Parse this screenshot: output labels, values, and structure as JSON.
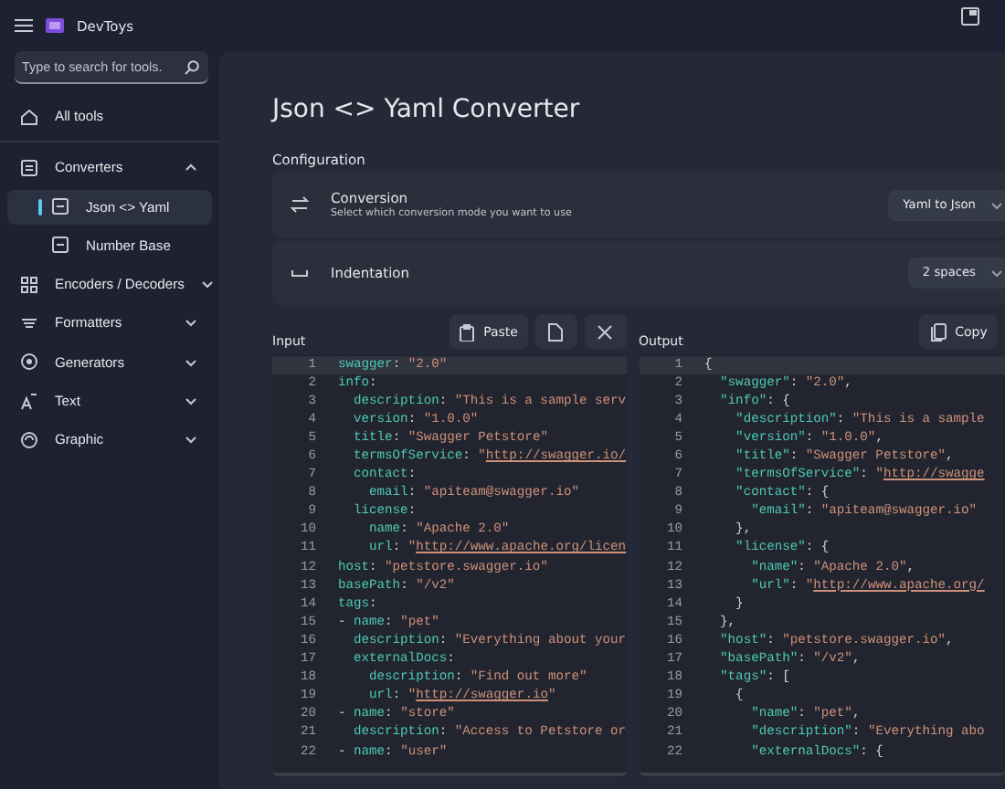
{
  "app": {
    "title": "DevToys"
  },
  "search": {
    "placeholder": "Type to search for tools."
  },
  "nav": [
    {
      "kind": "link",
      "label": "All tools",
      "selected": false
    },
    {
      "kind": "group",
      "label": "Converters",
      "selected": false,
      "expanded": true,
      "children": [
        {
          "label": "Json <> Yaml",
          "selected": true
        },
        {
          "label": "Number Base",
          "selected": false
        }
      ]
    },
    {
      "kind": "group",
      "label": "Encoders / Decoders",
      "selected": false,
      "expanded": false
    },
    {
      "kind": "group",
      "label": "Formatters",
      "selected": false,
      "expanded": false
    },
    {
      "kind": "group",
      "label": "Generators",
      "selected": false,
      "expanded": false
    },
    {
      "kind": "group",
      "label": "Text",
      "selected": false,
      "expanded": false
    },
    {
      "kind": "group",
      "label": "Graphic",
      "selected": false,
      "expanded": false
    }
  ],
  "tool": {
    "title": "Json <> Yaml Converter",
    "section": "Configuration",
    "settings": [
      {
        "kind": "conversion",
        "label": "Conversion",
        "description": "Select which conversion mode you want to use",
        "value": "Yaml to Json"
      },
      {
        "kind": "indentation",
        "label": "Indentation",
        "value": "2 spaces"
      }
    ]
  },
  "input": {
    "label": "Input",
    "actions": [
      {
        "kind": "paste",
        "label": "Paste"
      },
      {
        "kind": "open"
      },
      {
        "kind": "clear"
      }
    ],
    "lines": [
      {
        "number": "1",
        "current": true,
        "tokens": [
          {
            "kind": "key",
            "text": "swagger"
          },
          {
            "kind": "punct",
            "text": ": "
          },
          {
            "kind": "str",
            "text": "\"2.0\""
          }
        ]
      },
      {
        "number": "2",
        "current": false,
        "tokens": [
          {
            "kind": "key",
            "text": "info"
          },
          {
            "kind": "punct",
            "text": ":"
          }
        ]
      },
      {
        "number": "3",
        "current": false,
        "tokens": [
          {
            "kind": "key",
            "text": "  description"
          },
          {
            "kind": "punct",
            "text": ": "
          },
          {
            "kind": "str",
            "text": "\"This is a sample serv"
          }
        ]
      },
      {
        "number": "4",
        "current": false,
        "tokens": [
          {
            "kind": "key",
            "text": "  version"
          },
          {
            "kind": "punct",
            "text": ": "
          },
          {
            "kind": "str",
            "text": "\"1.0.0\""
          }
        ]
      },
      {
        "number": "5",
        "current": false,
        "tokens": [
          {
            "kind": "key",
            "text": "  title"
          },
          {
            "kind": "punct",
            "text": ": "
          },
          {
            "kind": "str",
            "text": "\"Swagger Petstore\""
          }
        ]
      },
      {
        "number": "6",
        "current": false,
        "tokens": [
          {
            "kind": "key",
            "text": "  termsOfService"
          },
          {
            "kind": "punct",
            "text": ": "
          },
          {
            "kind": "str",
            "text": "\""
          },
          {
            "kind": "url",
            "text": "http://swagger.io/"
          }
        ]
      },
      {
        "number": "7",
        "current": false,
        "tokens": [
          {
            "kind": "key",
            "text": "  contact"
          },
          {
            "kind": "punct",
            "text": ":"
          }
        ]
      },
      {
        "number": "8",
        "current": false,
        "tokens": [
          {
            "kind": "key",
            "text": "    email"
          },
          {
            "kind": "punct",
            "text": ": "
          },
          {
            "kind": "str",
            "text": "\"apiteam@swagger.io\""
          }
        ]
      },
      {
        "number": "9",
        "current": false,
        "tokens": [
          {
            "kind": "key",
            "text": "  license"
          },
          {
            "kind": "punct",
            "text": ":"
          }
        ]
      },
      {
        "number": "10",
        "current": false,
        "tokens": [
          {
            "kind": "key",
            "text": "    name"
          },
          {
            "kind": "punct",
            "text": ": "
          },
          {
            "kind": "str",
            "text": "\"Apache 2.0\""
          }
        ]
      },
      {
        "number": "11",
        "current": false,
        "tokens": [
          {
            "kind": "key",
            "text": "    url"
          },
          {
            "kind": "punct",
            "text": ": "
          },
          {
            "kind": "str",
            "text": "\""
          },
          {
            "kind": "url",
            "text": "http://www.apache.org/licen"
          }
        ]
      },
      {
        "number": "12",
        "current": false,
        "tokens": [
          {
            "kind": "key",
            "text": "host"
          },
          {
            "kind": "punct",
            "text": ": "
          },
          {
            "kind": "str",
            "text": "\"petstore.swagger.io\""
          }
        ]
      },
      {
        "number": "13",
        "current": false,
        "tokens": [
          {
            "kind": "key",
            "text": "basePath"
          },
          {
            "kind": "punct",
            "text": ": "
          },
          {
            "kind": "str",
            "text": "\"/v2\""
          }
        ]
      },
      {
        "number": "14",
        "current": false,
        "tokens": [
          {
            "kind": "key",
            "text": "tags"
          },
          {
            "kind": "punct",
            "text": ":"
          }
        ]
      },
      {
        "number": "15",
        "current": false,
        "tokens": [
          {
            "kind": "punct",
            "text": "- "
          },
          {
            "kind": "key",
            "text": "name"
          },
          {
            "kind": "punct",
            "text": ": "
          },
          {
            "kind": "str",
            "text": "\"pet\""
          }
        ]
      },
      {
        "number": "16",
        "current": false,
        "tokens": [
          {
            "kind": "key",
            "text": "  description"
          },
          {
            "kind": "punct",
            "text": ": "
          },
          {
            "kind": "str",
            "text": "\"Everything about your"
          }
        ]
      },
      {
        "number": "17",
        "current": false,
        "tokens": [
          {
            "kind": "key",
            "text": "  externalDocs"
          },
          {
            "kind": "punct",
            "text": ":"
          }
        ]
      },
      {
        "number": "18",
        "current": false,
        "tokens": [
          {
            "kind": "key",
            "text": "    description"
          },
          {
            "kind": "punct",
            "text": ": "
          },
          {
            "kind": "str",
            "text": "\"Find out more\""
          }
        ]
      },
      {
        "number": "19",
        "current": false,
        "tokens": [
          {
            "kind": "key",
            "text": "    url"
          },
          {
            "kind": "punct",
            "text": ": "
          },
          {
            "kind": "str",
            "text": "\""
          },
          {
            "kind": "url",
            "text": "http://swagger.io"
          },
          {
            "kind": "str",
            "text": "\""
          }
        ]
      },
      {
        "number": "20",
        "current": false,
        "tokens": [
          {
            "kind": "punct",
            "text": "- "
          },
          {
            "kind": "key",
            "text": "name"
          },
          {
            "kind": "punct",
            "text": ": "
          },
          {
            "kind": "str",
            "text": "\"store\""
          }
        ]
      },
      {
        "number": "21",
        "current": false,
        "tokens": [
          {
            "kind": "key",
            "text": "  description"
          },
          {
            "kind": "punct",
            "text": ": "
          },
          {
            "kind": "str",
            "text": "\"Access to Petstore or"
          }
        ]
      },
      {
        "number": "22",
        "current": false,
        "tokens": [
          {
            "kind": "punct",
            "text": "- "
          },
          {
            "kind": "key",
            "text": "name"
          },
          {
            "kind": "punct",
            "text": ": "
          },
          {
            "kind": "str",
            "text": "\"user\""
          }
        ]
      }
    ]
  },
  "output": {
    "label": "Output",
    "actions": [
      {
        "kind": "copy",
        "label": "Copy"
      }
    ],
    "lines": [
      {
        "number": "1",
        "current": true,
        "tokens": [
          {
            "kind": "punct",
            "text": "{"
          }
        ]
      },
      {
        "number": "2",
        "current": false,
        "tokens": [
          {
            "kind": "key",
            "text": "  \"swagger\""
          },
          {
            "kind": "punct",
            "text": ": "
          },
          {
            "kind": "str",
            "text": "\"2.0\""
          },
          {
            "kind": "punct",
            "text": ","
          }
        ]
      },
      {
        "number": "3",
        "current": false,
        "tokens": [
          {
            "kind": "key",
            "text": "  \"info\""
          },
          {
            "kind": "punct",
            "text": ": {"
          }
        ]
      },
      {
        "number": "4",
        "current": false,
        "tokens": [
          {
            "kind": "key",
            "text": "    \"description\""
          },
          {
            "kind": "punct",
            "text": ": "
          },
          {
            "kind": "str",
            "text": "\"This is a sample"
          }
        ]
      },
      {
        "number": "5",
        "current": false,
        "tokens": [
          {
            "kind": "key",
            "text": "    \"version\""
          },
          {
            "kind": "punct",
            "text": ": "
          },
          {
            "kind": "str",
            "text": "\"1.0.0\""
          },
          {
            "kind": "punct",
            "text": ","
          }
        ]
      },
      {
        "number": "6",
        "current": false,
        "tokens": [
          {
            "kind": "key",
            "text": "    \"title\""
          },
          {
            "kind": "punct",
            "text": ": "
          },
          {
            "kind": "str",
            "text": "\"Swagger Petstore\""
          },
          {
            "kind": "punct",
            "text": ","
          }
        ]
      },
      {
        "number": "7",
        "current": false,
        "tokens": [
          {
            "kind": "key",
            "text": "    \"termsOfService\""
          },
          {
            "kind": "punct",
            "text": ": "
          },
          {
            "kind": "str",
            "text": "\""
          },
          {
            "kind": "url",
            "text": "http://swagge"
          }
        ]
      },
      {
        "number": "8",
        "current": false,
        "tokens": [
          {
            "kind": "key",
            "text": "    \"contact\""
          },
          {
            "kind": "punct",
            "text": ": {"
          }
        ]
      },
      {
        "number": "9",
        "current": false,
        "tokens": [
          {
            "kind": "key",
            "text": "      \"email\""
          },
          {
            "kind": "punct",
            "text": ": "
          },
          {
            "kind": "str",
            "text": "\"apiteam@swagger.io\""
          }
        ]
      },
      {
        "number": "10",
        "current": false,
        "tokens": [
          {
            "kind": "punct",
            "text": "    },"
          }
        ]
      },
      {
        "number": "11",
        "current": false,
        "tokens": [
          {
            "kind": "key",
            "text": "    \"license\""
          },
          {
            "kind": "punct",
            "text": ": {"
          }
        ]
      },
      {
        "number": "12",
        "current": false,
        "tokens": [
          {
            "kind": "key",
            "text": "      \"name\""
          },
          {
            "kind": "punct",
            "text": ": "
          },
          {
            "kind": "str",
            "text": "\"Apache 2.0\""
          },
          {
            "kind": "punct",
            "text": ","
          }
        ]
      },
      {
        "number": "13",
        "current": false,
        "tokens": [
          {
            "kind": "key",
            "text": "      \"url\""
          },
          {
            "kind": "punct",
            "text": ": "
          },
          {
            "kind": "str",
            "text": "\""
          },
          {
            "kind": "url",
            "text": "http://www.apache.org/"
          }
        ]
      },
      {
        "number": "14",
        "current": false,
        "tokens": [
          {
            "kind": "punct",
            "text": "    }"
          }
        ]
      },
      {
        "number": "15",
        "current": false,
        "tokens": [
          {
            "kind": "punct",
            "text": "  },"
          }
        ]
      },
      {
        "number": "16",
        "current": false,
        "tokens": [
          {
            "kind": "key",
            "text": "  \"host\""
          },
          {
            "kind": "punct",
            "text": ": "
          },
          {
            "kind": "str",
            "text": "\"petstore.swagger.io\""
          },
          {
            "kind": "punct",
            "text": ","
          }
        ]
      },
      {
        "number": "17",
        "current": false,
        "tokens": [
          {
            "kind": "key",
            "text": "  \"basePath\""
          },
          {
            "kind": "punct",
            "text": ": "
          },
          {
            "kind": "str",
            "text": "\"/v2\""
          },
          {
            "kind": "punct",
            "text": ","
          }
        ]
      },
      {
        "number": "18",
        "current": false,
        "tokens": [
          {
            "kind": "key",
            "text": "  \"tags\""
          },
          {
            "kind": "punct",
            "text": ": ["
          }
        ]
      },
      {
        "number": "19",
        "current": false,
        "tokens": [
          {
            "kind": "punct",
            "text": "    {"
          }
        ]
      },
      {
        "number": "20",
        "current": false,
        "tokens": [
          {
            "kind": "key",
            "text": "      \"name\""
          },
          {
            "kind": "punct",
            "text": ": "
          },
          {
            "kind": "str",
            "text": "\"pet\""
          },
          {
            "kind": "punct",
            "text": ","
          }
        ]
      },
      {
        "number": "21",
        "current": false,
        "tokens": [
          {
            "kind": "key",
            "text": "      \"description\""
          },
          {
            "kind": "punct",
            "text": ": "
          },
          {
            "kind": "str",
            "text": "\"Everything abo"
          }
        ]
      },
      {
        "number": "22",
        "current": false,
        "tokens": [
          {
            "kind": "key",
            "text": "      \"externalDocs\""
          },
          {
            "kind": "punct",
            "text": ": {"
          }
        ]
      }
    ]
  }
}
